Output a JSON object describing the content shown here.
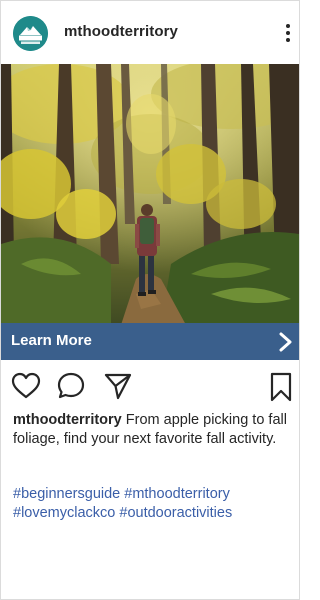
{
  "header": {
    "username": "mthoodterritory",
    "avatar_logo_text": "MT. HOOD",
    "avatar_color": "#1f8a8a",
    "more_icon": "more-vertical-icon"
  },
  "photo": {
    "description_icon": "forest-hiker-photo"
  },
  "cta": {
    "label": "Learn More",
    "color": "#3a5f8c",
    "icon": "chevron-right-icon"
  },
  "actions": {
    "like_icon": "heart-icon",
    "comment_icon": "comment-icon",
    "share_icon": "send-icon",
    "save_icon": "bookmark-icon"
  },
  "caption": {
    "username": "mthoodterritory",
    "text": " From apple picking to fall foliage, find your next favorite fall activity."
  },
  "hashtags": {
    "color": "#3a5ea8",
    "tags": [
      "#beginnersguide",
      "#mthoodterritory",
      "#lovemyclackco",
      "#outdooractivities"
    ]
  }
}
